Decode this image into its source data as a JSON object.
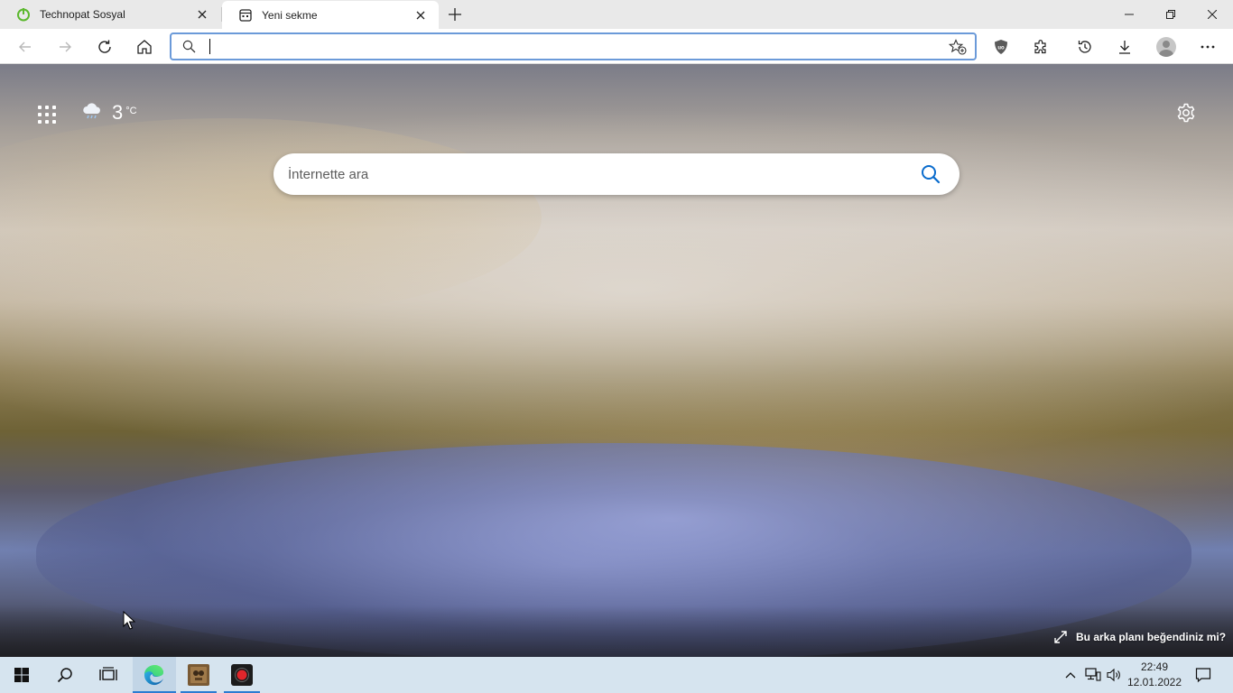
{
  "browser": {
    "tabs": [
      {
        "label": "Technopat Sosyal",
        "active": false
      },
      {
        "label": "Yeni sekme",
        "active": true
      }
    ],
    "address_bar": {
      "value": "",
      "placeholder": ""
    }
  },
  "ntp": {
    "weather": {
      "temperature": "3",
      "unit": "°C",
      "icon": "cloud-rain-icon"
    },
    "search": {
      "placeholder": "İnternette ara"
    },
    "background_feedback": "Bu arka planı beğendiniz mi?"
  },
  "taskbar": {
    "time": "22:49",
    "date": "12.01.2022"
  },
  "colors": {
    "accent": "#0a6ccd",
    "address_border": "#6b9ad9",
    "taskbar": "#d6e4ef",
    "tabstrip": "#e9e9e9"
  }
}
